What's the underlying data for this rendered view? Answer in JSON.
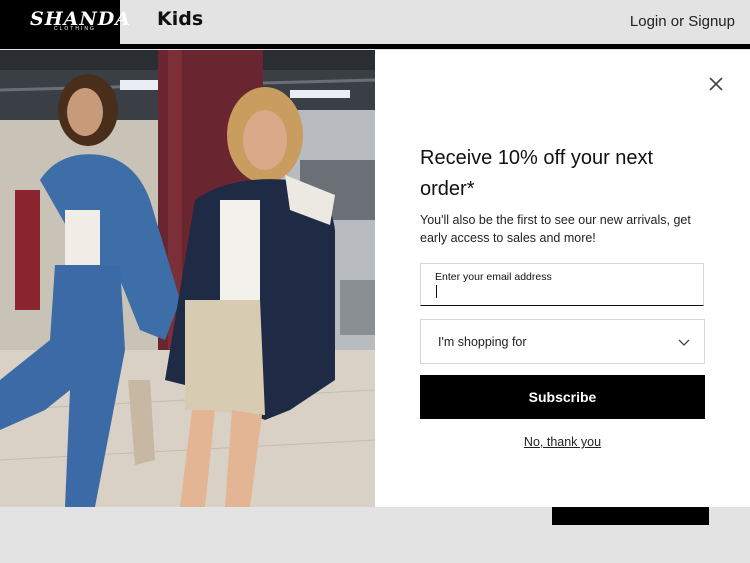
{
  "header": {
    "brand": "SHANDA",
    "brand_sub": "CLOTHING",
    "kids_label": "Kids",
    "login_label": "Login or Signup"
  },
  "popup": {
    "headline": "Receive 10% off your next order*",
    "subtext": "You'll also be the first to see our new arrivals, get early access to sales and more!",
    "email_label": "Enter your email address",
    "email_value": "",
    "shopping_for": "I'm shopping for",
    "subscribe_label": "Subscribe",
    "decline_label": "No, thank you"
  },
  "colors": {
    "accent": "#000000",
    "page_bg": "#e3e3e3"
  },
  "icons": [
    "close-icon",
    "chevron-down-icon"
  ]
}
